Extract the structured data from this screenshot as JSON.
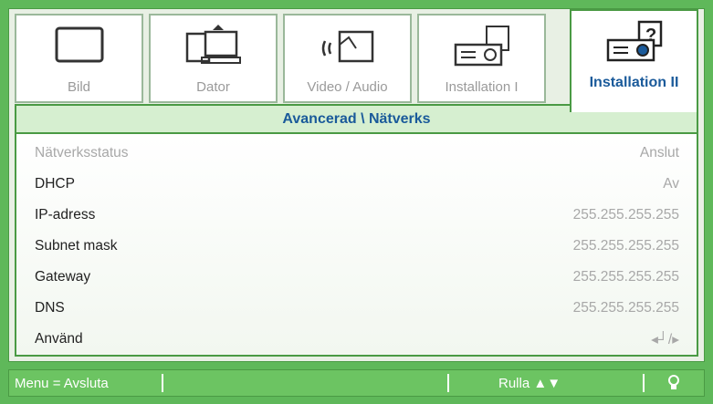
{
  "tabs": [
    {
      "label": "Bild",
      "icon": "monitor-icon"
    },
    {
      "label": "Dator",
      "icon": "computer-icon"
    },
    {
      "label": "Video / Audio",
      "icon": "video-audio-icon"
    },
    {
      "label": "Installation I",
      "icon": "projector-icon"
    },
    {
      "label": "Installation II",
      "icon": "projector-help-icon"
    }
  ],
  "active_tab": "Installation II",
  "subtitle": "Avancerad \\ Nätverks",
  "rows": [
    {
      "label": "Nätverksstatus",
      "value": "Anslut"
    },
    {
      "label": "DHCP",
      "value": "Av"
    },
    {
      "label": "IP-adress",
      "value": "255.255.255.255"
    },
    {
      "label": "Subnet mask",
      "value": "255.255.255.255"
    },
    {
      "label": "Gateway",
      "value": "255.255.255.255"
    },
    {
      "label": "DNS",
      "value": "255.255.255.255"
    },
    {
      "label": "Använd",
      "value": "◂┘/▸"
    }
  ],
  "status": {
    "menu": "Menu = Avsluta",
    "scroll": "Rulla ▲▼",
    "help_icon": "lightbulb-icon"
  },
  "colors": {
    "accent_green": "#5fb85a",
    "active_text": "#1a5a9a"
  }
}
